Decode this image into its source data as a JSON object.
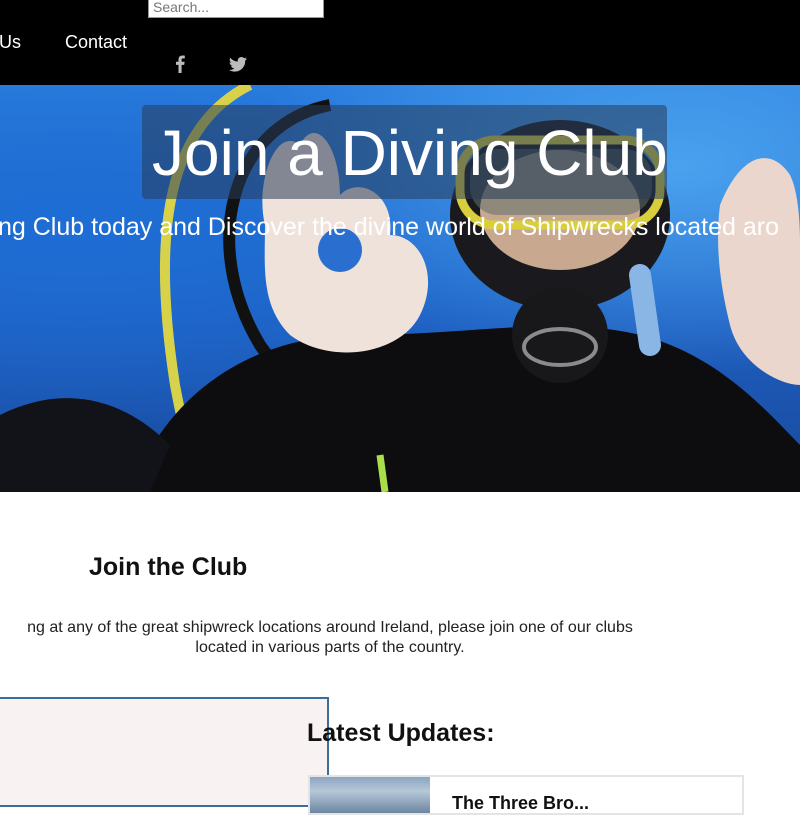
{
  "header": {
    "search_placeholder": "Search...",
    "nav": [
      {
        "label": "Us"
      },
      {
        "label": "Contact"
      }
    ],
    "social": [
      {
        "icon": "facebook-icon"
      },
      {
        "icon": "twitter-icon"
      }
    ]
  },
  "hero": {
    "title": "Join a Diving Club",
    "subtitle": "ng Club today and Discover the divine world of Shipwrecks located aro"
  },
  "main": {
    "section_title": "Join the Club",
    "intro_line1": "ng at any of the great shipwreck locations around Ireland, please join one of our clubs",
    "intro_line2": "located in various parts of the country.",
    "updates_title": "Latest Updates:",
    "update_item_heading": "The Three Bro..."
  },
  "colors": {
    "nav_bg": "#000000",
    "panel_border": "#3c6d98",
    "panel_bg": "#f8f2f2"
  }
}
